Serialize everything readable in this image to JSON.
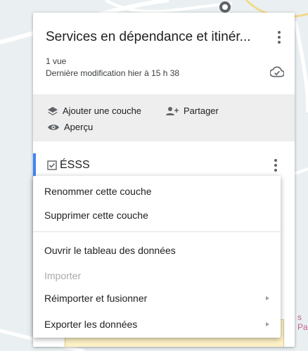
{
  "map_panel": {
    "title": "Services en dépendance et itinér...",
    "views": "1 vue",
    "last_modified": "Dernière modification hier à 15 h 38"
  },
  "actions": {
    "add_layer": "Ajouter une couche",
    "share": "Partager",
    "preview": "Aperçu"
  },
  "layer": {
    "name": "ÉSSS",
    "checked": true
  },
  "context_menu": {
    "rename": "Renommer cette couche",
    "delete": "Supprimer cette couche",
    "open_table": "Ouvrir le tableau des données",
    "import": "Importer",
    "reimport_merge": "Réimporter et fusionner",
    "export": "Exporter les données"
  },
  "map_edge_label": {
    "line1": "s",
    "line2": "Pa"
  },
  "colors": {
    "accent": "#4285f4",
    "text": "#202124",
    "disabled": "#a7a9ac",
    "action_bar": "#eeeeee"
  },
  "icons": {
    "more": "more-vert-icon",
    "cloud": "cloud-check-icon",
    "layers": "layers-icon",
    "share": "person-add-icon",
    "preview": "eye-icon",
    "checkbox": "checkbox-checked-icon",
    "submenu": "arrow-right-icon"
  }
}
